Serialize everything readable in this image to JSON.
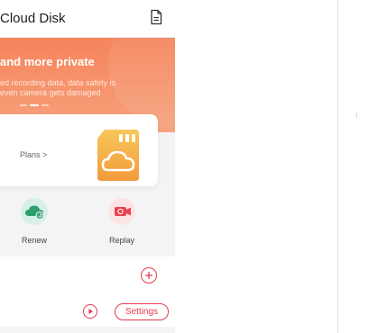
{
  "header": {
    "title": "Cloud Disk",
    "doc_icon": "document-icon"
  },
  "banner": {
    "headline": "and more private",
    "line1": "ed recording data, data safety is",
    "line2": "even camera gets damaged",
    "pager": {
      "count": 3,
      "active_index": 1
    },
    "colors": {
      "top": "#f5845c",
      "bottom": "#f7a27c"
    }
  },
  "plan_card": {
    "plans_link": "Plans >",
    "icon": "sd-card-cloud-icon"
  },
  "actions": [
    {
      "label": "Renew",
      "icon": "cloud-renew-icon",
      "color": "#2f9e6e"
    },
    {
      "label": "Replay",
      "icon": "video-camera-icon",
      "color": "#e8424f"
    }
  ],
  "panel": {
    "add_icon": "plus-circle-icon",
    "play_icon": "play-circle-icon",
    "settings_label": "Settings",
    "accent": "#e53b4a"
  },
  "side_mark": "⁝"
}
